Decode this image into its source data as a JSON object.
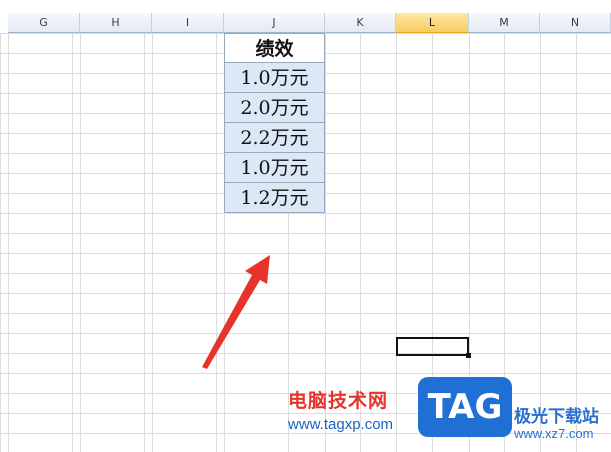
{
  "columns": [
    {
      "label": "G"
    },
    {
      "label": "H"
    },
    {
      "label": "I"
    },
    {
      "label": "J"
    },
    {
      "label": "K"
    },
    {
      "label": "L"
    },
    {
      "label": "M"
    },
    {
      "label": "N"
    }
  ],
  "selected_column": "L",
  "table": {
    "header": "绩效",
    "values": [
      "1.0万元",
      "2.0万元",
      "2.2万元",
      "1.0万元",
      "1.2万元"
    ]
  },
  "annotation": {
    "type": "arrow",
    "color": "#e8332a"
  },
  "watermark": {
    "name_cn": "电脑技术网",
    "url": "www.tagxp.com",
    "logo_text": "TAG",
    "site_cn": "极光下载站",
    "site_url": "www.xz7.com"
  }
}
